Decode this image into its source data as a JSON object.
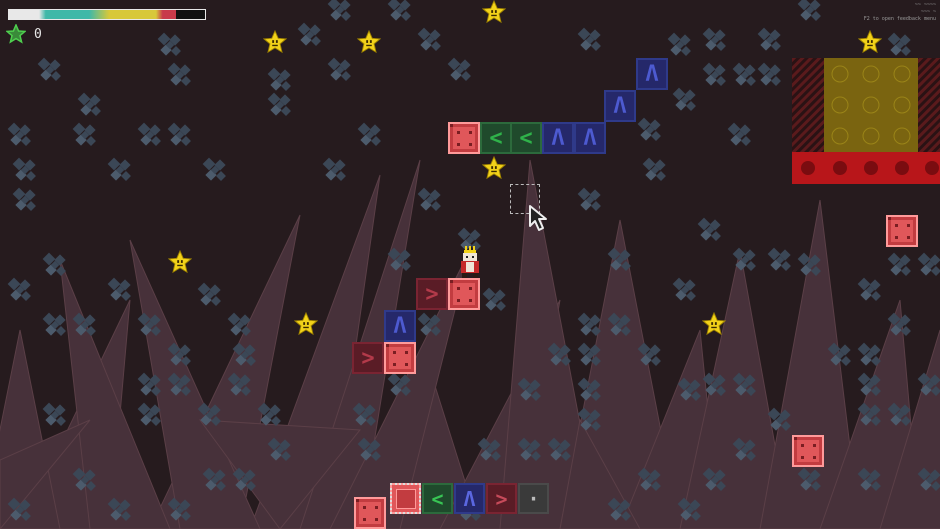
{
  "hud": {
    "health_fraction": 0.85,
    "stars_collected": "0",
    "debug_lines": [
      "~~ ~~~~",
      "~~~ ~",
      "F2 to open feedback menu"
    ],
    "colors": {
      "health_teal": "#3fb8a8",
      "health_yellow": "#d8c83a",
      "health_red": "#c83a4a",
      "health_white": "#e8e8e8"
    }
  },
  "stars": [
    {
      "name": "star-1"
    },
    {
      "name": "star-2"
    },
    {
      "name": "star-3"
    },
    {
      "name": "star-4"
    },
    {
      "name": "star-5"
    },
    {
      "name": "star-6"
    },
    {
      "name": "star-7"
    },
    {
      "name": "star-8"
    }
  ],
  "toolbar": {
    "tools": [
      {
        "name": "tool-crate",
        "icon": "crate-icon",
        "glyph": "",
        "kind": "crate",
        "selected": true
      },
      {
        "name": "tool-arrow-left",
        "icon": "arrow-left-icon",
        "glyph": "<",
        "kind": "left"
      },
      {
        "name": "tool-arrow-up",
        "icon": "arrow-up-icon",
        "glyph": "Λ",
        "kind": "up"
      },
      {
        "name": "tool-arrow-right",
        "icon": "arrow-right-icon",
        "glyph": ">",
        "kind": "right"
      },
      {
        "name": "tool-eraser",
        "icon": "dot-icon",
        "glyph": "·",
        "kind": "empty"
      }
    ]
  },
  "colors": {
    "background": "#261b1e",
    "spike": "#4a3438",
    "rock": "#3e4a58",
    "star": "#f2d21a",
    "crate": "#e0575a",
    "exit_gold": "#8a7412",
    "exit_red": "#c0181c"
  }
}
